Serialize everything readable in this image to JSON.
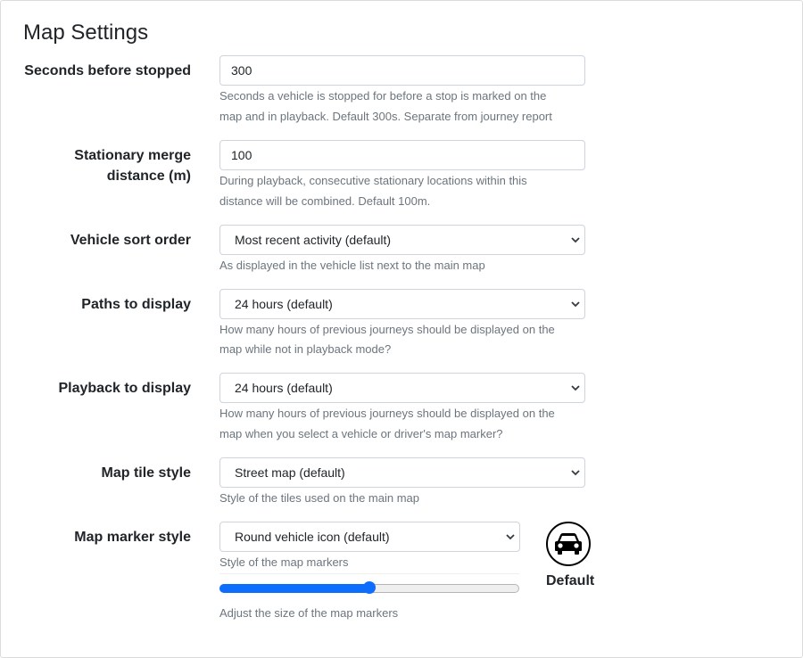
{
  "title": "Map Settings",
  "fields": {
    "seconds_before_stopped": {
      "label": "Seconds before stopped",
      "value": "300",
      "help_line1": "Seconds a vehicle is stopped for before a stop is marked on the",
      "help_line2": "map and in playback. Default 300s. Separate from journey report"
    },
    "stationary_merge": {
      "label_line1": "Stationary merge",
      "label_line2": "distance (m)",
      "value": "100",
      "help_line1": "During playback, consecutive stationary locations within this",
      "help_line2": "distance will be combined. Default 100m."
    },
    "vehicle_sort_order": {
      "label": "Vehicle sort order",
      "selected": "Most recent activity (default)",
      "help": "As displayed in the vehicle list next to the main map"
    },
    "paths_to_display": {
      "label": "Paths to display",
      "selected": "24 hours (default)",
      "help_line1": "How many hours of previous journeys should be displayed on the",
      "help_line2": "map while not in playback mode?"
    },
    "playback_to_display": {
      "label": "Playback to display",
      "selected": "24 hours (default)",
      "help_line1": "How many hours of previous journeys should be displayed on the",
      "help_line2": "map when you select a vehicle or driver's map marker?"
    },
    "map_tile_style": {
      "label": "Map tile style",
      "selected": "Street map (default)",
      "help": "Style of the tiles used on the main map"
    },
    "map_marker_style": {
      "label": "Map marker style",
      "selected": "Round vehicle icon (default)",
      "help": "Style of the map markers",
      "size_help": "Adjust the size of the map markers",
      "size_value": 0.5
    }
  },
  "preview": {
    "icon": "car-icon",
    "label": "Default"
  },
  "colors": {
    "accent": "#0d6efd",
    "help_text": "#6c757d"
  }
}
